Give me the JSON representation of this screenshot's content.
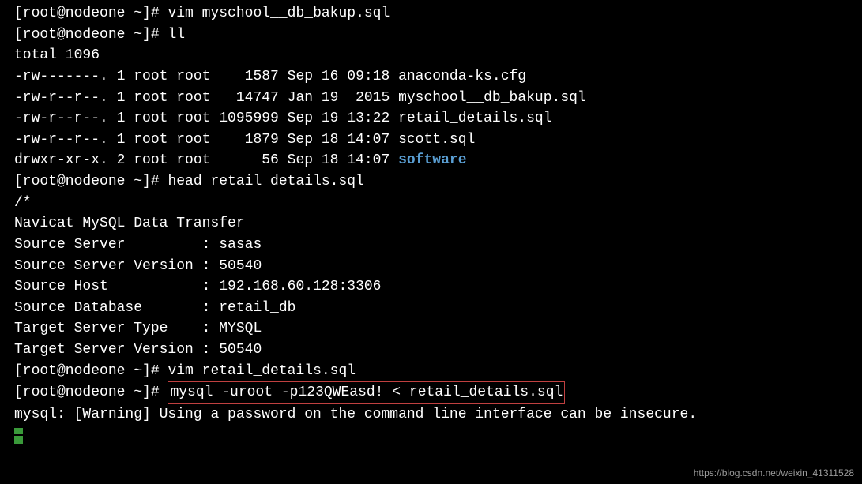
{
  "prompt1": "[root@nodeone ~]# ",
  "cmd_vim1": "vim myschool__db_bakup.sql",
  "cmd_ll": "ll",
  "total_line": "total 1096",
  "ls": [
    "-rw-------. 1 root root    1587 Sep 16 09:18 anaconda-ks.cfg",
    "-rw-r--r--. 1 root root   14747 Jan 19  2015 myschool__db_bakup.sql",
    "-rw-r--r--. 1 root root 1095999 Sep 19 13:22 retail_details.sql",
    "-rw-r--r--. 1 root root    1879 Sep 18 14:07 scott.sql"
  ],
  "ls_dir_prefix": "drwxr-xr-x. 2 root root      56 Sep 18 14:07 ",
  "ls_dir_name": "software",
  "cmd_head": "head retail_details.sql",
  "head_out": [
    "/*",
    "Navicat MySQL Data Transfer",
    "",
    "Source Server         : sasas",
    "Source Server Version : 50540",
    "Source Host           : 192.168.60.128:3306",
    "Source Database       : retail_db",
    "",
    "Target Server Type    : MYSQL",
    "Target Server Version : 50540"
  ],
  "cmd_vim2": "vim retail_details.sql",
  "cmd_mysql": "mysql -uroot -p123QWEasd! < retail_details.sql",
  "mysql_warn": "mysql: [Warning] Using a password on the command line interface can be insecure.",
  "watermark": "https://blog.csdn.net/weixin_41311528"
}
